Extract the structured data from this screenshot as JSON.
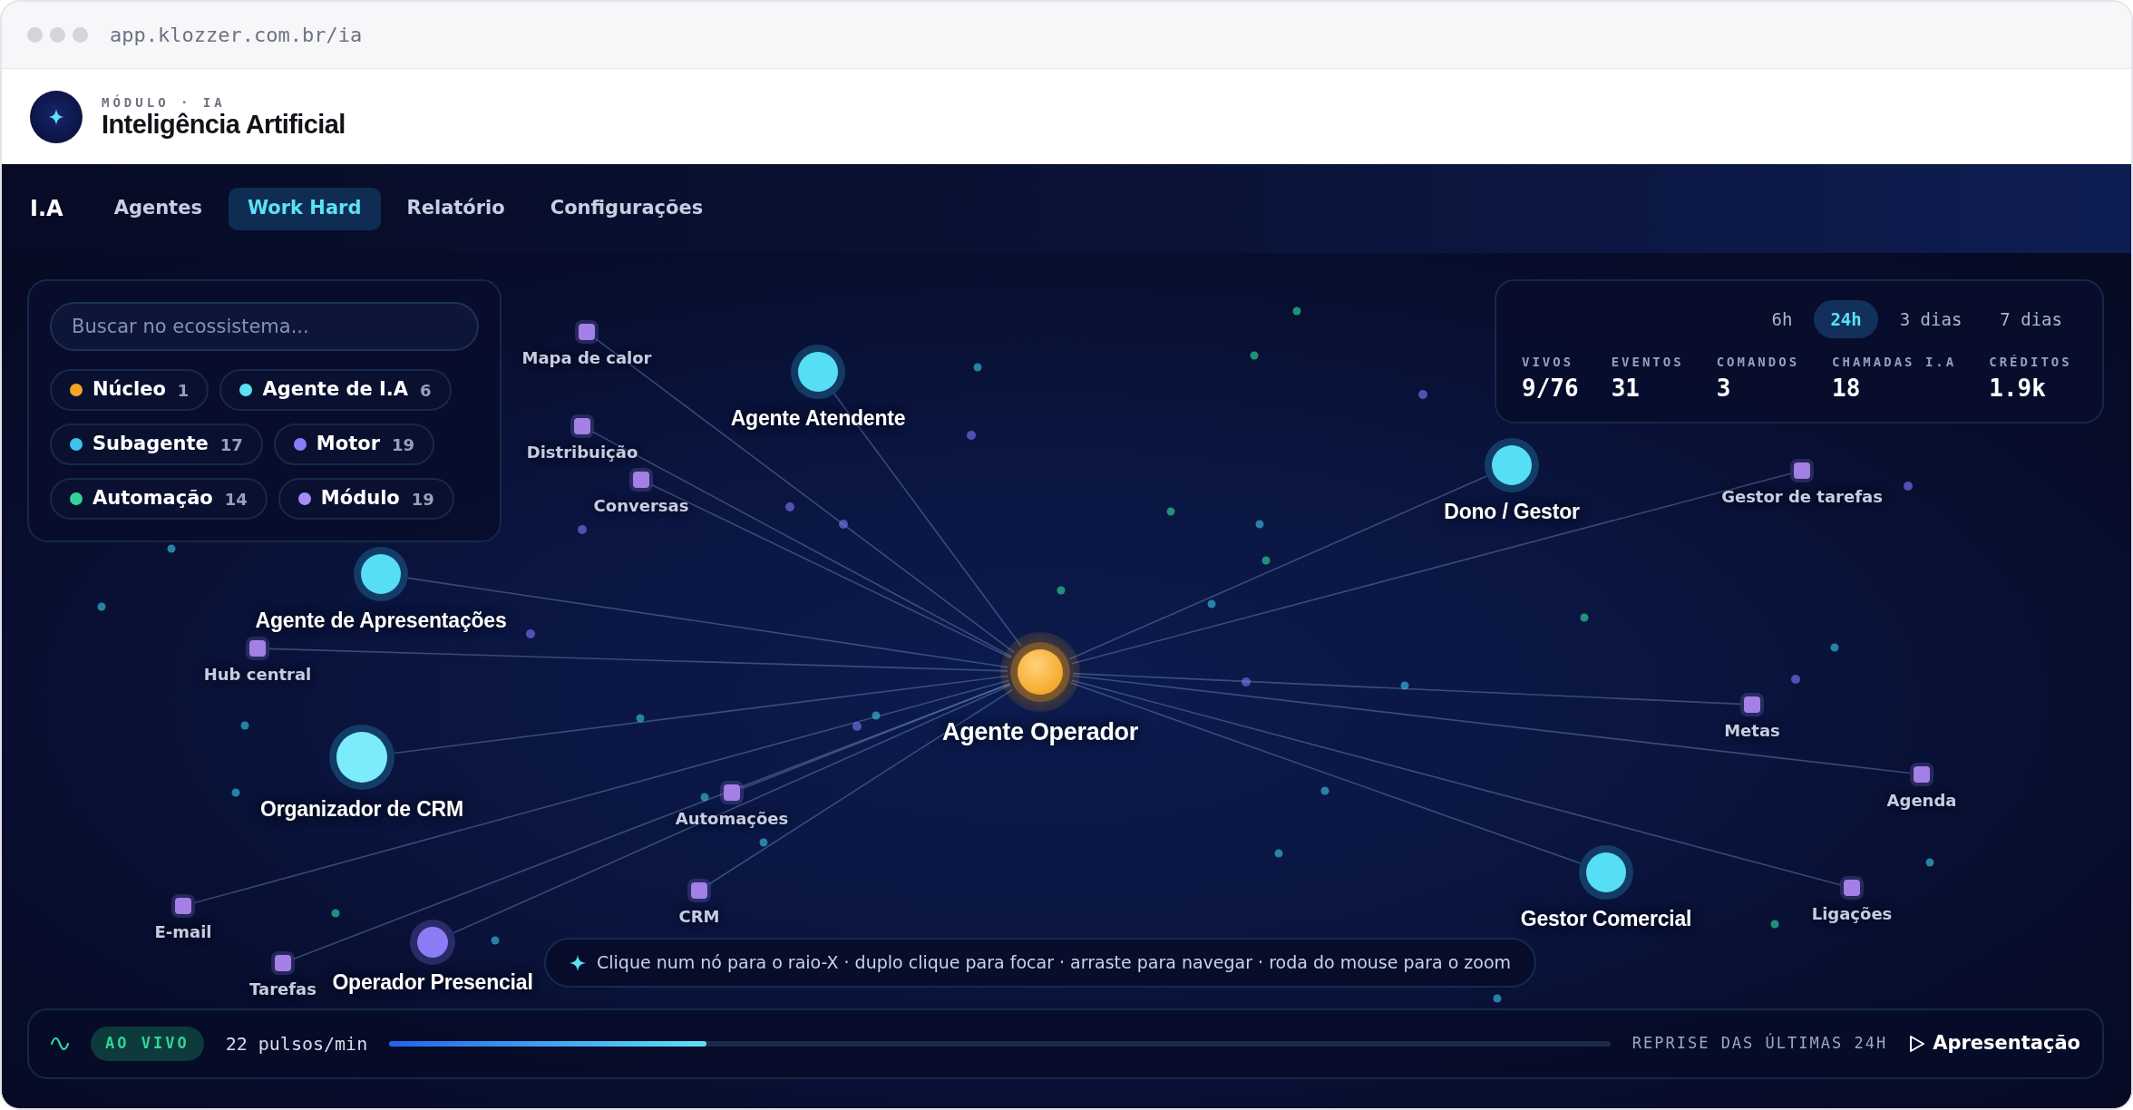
{
  "browser": {
    "url": "app.klozzer.com.br/ia"
  },
  "header": {
    "eyebrow": "MÓDULO · IA",
    "title": "Inteligência Artificial"
  },
  "nav": {
    "brand": "I.A",
    "tabs": [
      {
        "label": "Agentes",
        "selected": false
      },
      {
        "label": "Work Hard",
        "selected": true
      },
      {
        "label": "Relatório",
        "selected": false
      },
      {
        "label": "Configurações",
        "selected": false
      }
    ]
  },
  "filter_panel": {
    "search": {
      "placeholder": "Buscar no ecossistema..."
    },
    "legend": [
      {
        "label": "Núcleo",
        "count": "1",
        "color": "#f5a524"
      },
      {
        "label": "Agente de I.A",
        "count": "6",
        "color": "#5ce1f5"
      },
      {
        "label": "Subagente",
        "count": "17",
        "color": "#3cc3ec"
      },
      {
        "label": "Motor",
        "count": "19",
        "color": "#8b7cf6"
      },
      {
        "label": "Automação",
        "count": "14",
        "color": "#34d399"
      },
      {
        "label": "Módulo",
        "count": "19",
        "color": "#a78bfa"
      }
    ]
  },
  "stats_panel": {
    "range_tabs": [
      {
        "label": "6h",
        "selected": false
      },
      {
        "label": "24h",
        "selected": true
      },
      {
        "label": "3 dias",
        "selected": false
      },
      {
        "label": "7 dias",
        "selected": false
      }
    ],
    "stats": [
      {
        "label": "VIVOS",
        "value": "9/76"
      },
      {
        "label": "EVENTOS",
        "value": "31"
      },
      {
        "label": "COMANDOS",
        "value": "3"
      },
      {
        "label": "CHAMADAS I.A",
        "value": "18"
      },
      {
        "label": "CRÉDITOS",
        "value": "1.9k"
      }
    ]
  },
  "graph": {
    "nodes": [
      {
        "label": "Mapa de calor",
        "kind": "modulo"
      },
      {
        "label": "Agente Atendente",
        "kind": "agente"
      },
      {
        "label": "Gestor de tarefas",
        "kind": "modulo"
      },
      {
        "label": "Distribuição",
        "kind": "modulo"
      },
      {
        "label": "Dono / Gestor",
        "kind": "agente"
      },
      {
        "label": "Conversas",
        "kind": "modulo"
      },
      {
        "label": "Agente de Apresentações",
        "kind": "agente"
      },
      {
        "label": "Hub central",
        "kind": "modulo"
      },
      {
        "label": "Agente Operador",
        "kind": "nucleo"
      },
      {
        "label": "Metas",
        "kind": "modulo"
      },
      {
        "label": "Agenda",
        "kind": "modulo"
      },
      {
        "label": "Organizador de CRM",
        "kind": "agente"
      },
      {
        "label": "Automações",
        "kind": "modulo"
      },
      {
        "label": "E-mail",
        "kind": "modulo"
      },
      {
        "label": "CRM",
        "kind": "modulo"
      },
      {
        "label": "Tarefas",
        "kind": "modulo"
      },
      {
        "label": "Operador Presencial",
        "kind": "motor"
      },
      {
        "label": "Gestor Comercial",
        "kind": "agente"
      },
      {
        "label": "Ligações",
        "kind": "modulo"
      }
    ],
    "hint": "Clique num nó para o raio-X · duplo clique para focar · arraste para navegar · roda do mouse para o zoom"
  },
  "playback": {
    "live_badge": "AO VIVO",
    "rate": "22 pulsos/min",
    "level": 0.26,
    "replay_label": "REPRISE DAS ÚLTIMAS 24H",
    "present_button": "Apresentação"
  }
}
